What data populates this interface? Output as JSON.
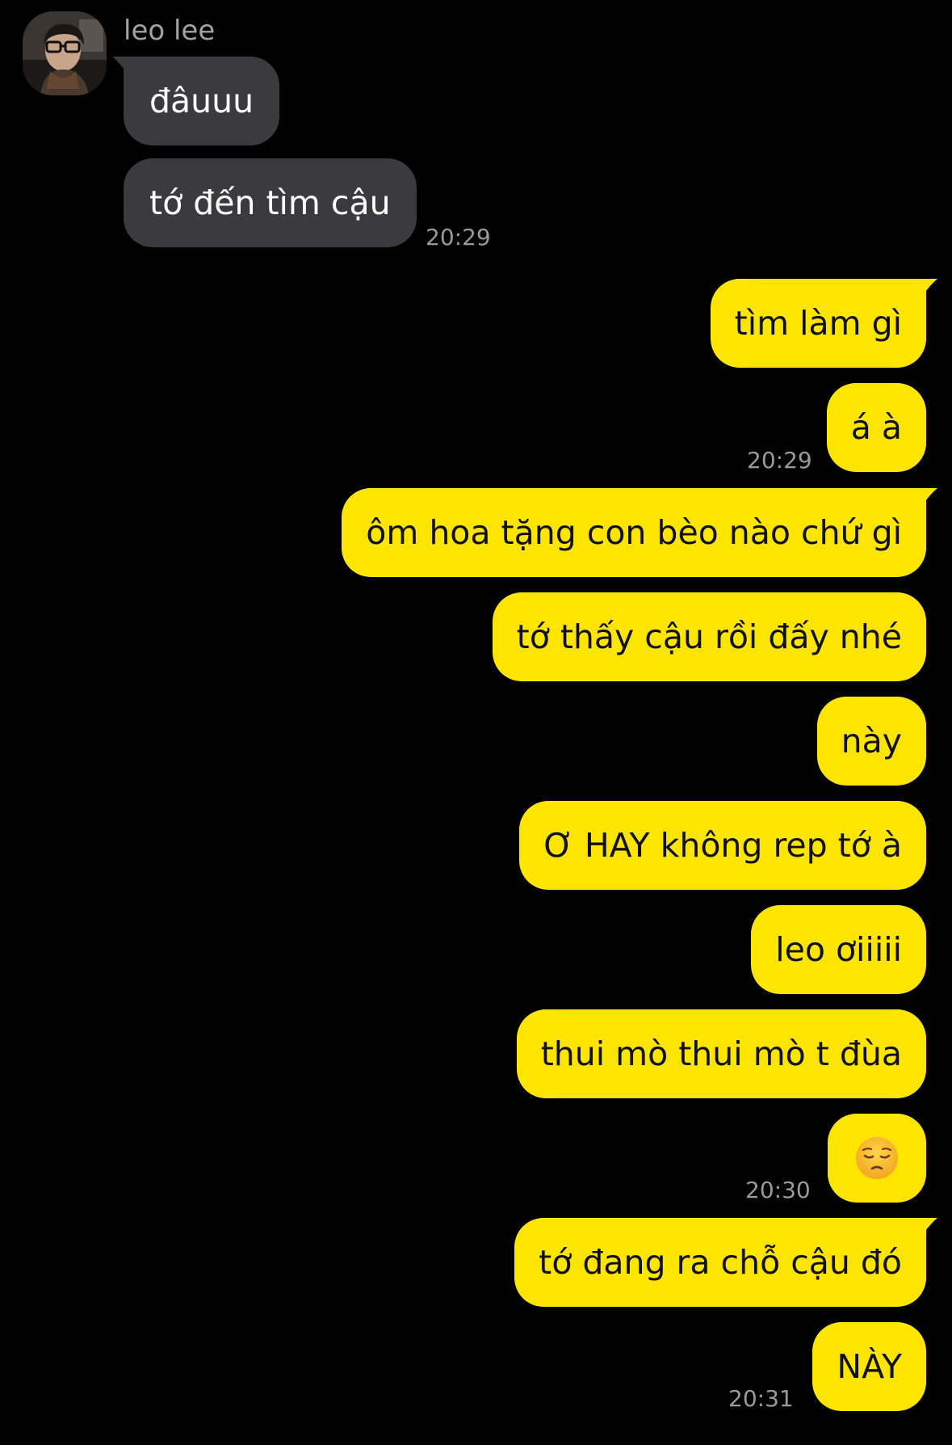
{
  "colors": {
    "background": "#000000",
    "incoming_bubble": "#3b3b3d",
    "outgoing_bubble": "#fee500",
    "timestamp": "#9a9a9a",
    "sender_name": "#a3a3a3"
  },
  "contact": {
    "name": "leo lee",
    "avatar_icon": "profile-photo"
  },
  "messages": [
    {
      "direction": "in",
      "text": "đâuuu"
    },
    {
      "direction": "in",
      "text": "tớ đến tìm cậu",
      "time": "20:29"
    },
    {
      "direction": "out",
      "text": "tìm làm gì"
    },
    {
      "direction": "out",
      "text": "á à",
      "time": "20:29"
    },
    {
      "direction": "out",
      "text": "ôm hoa tặng con bèo nào chứ gì"
    },
    {
      "direction": "out",
      "text": "tớ thấy cậu rồi đấy nhé"
    },
    {
      "direction": "out",
      "text": "này"
    },
    {
      "direction": "out",
      "text": "Ơ HAY không rep tớ à"
    },
    {
      "direction": "out",
      "text": "leo ơiiiii"
    },
    {
      "direction": "out",
      "text": "thui mò thui mò t đùa"
    },
    {
      "direction": "out",
      "text": "",
      "emoji": "pensive-face-emoji",
      "time": "20:30"
    },
    {
      "direction": "out",
      "text": "tớ đang ra chỗ cậu đó"
    },
    {
      "direction": "out",
      "text": "NÀY",
      "time": "20:31"
    }
  ]
}
